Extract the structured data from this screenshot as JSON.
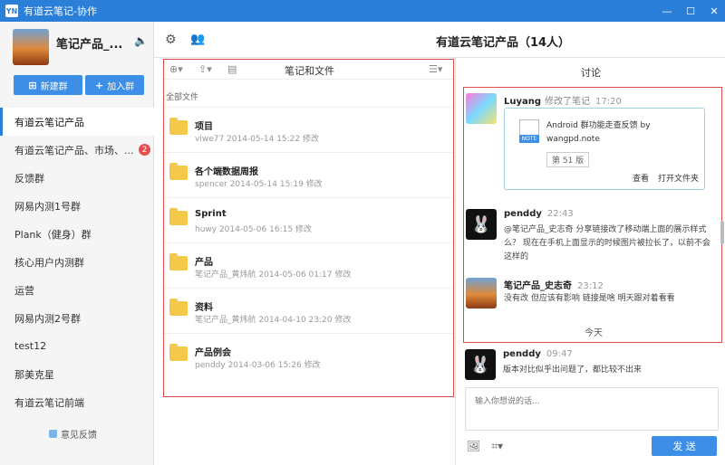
{
  "window": {
    "title": "有道云笔记-协作",
    "app_icon": "YN"
  },
  "group": {
    "name": "笔记产品_...",
    "speaker_icon": "speaker-icon"
  },
  "buttons": {
    "new_group": "新建群",
    "join_group": "加入群"
  },
  "groups": [
    {
      "label": "有道云笔记产品",
      "active": true
    },
    {
      "label": "有道云笔记产品、市场、...",
      "badge": "2"
    },
    {
      "label": "反馈群"
    },
    {
      "label": "网易内测1号群"
    },
    {
      "label": "Plank（健身）群"
    },
    {
      "label": "核心用户内测群"
    },
    {
      "label": "运营"
    },
    {
      "label": "网易内测2号群"
    },
    {
      "label": "test12"
    },
    {
      "label": "那美克星"
    },
    {
      "label": "有道云笔记前端"
    }
  ],
  "feedback": "意见反馈",
  "header": {
    "title": "有道云笔记产品（14人）"
  },
  "files": {
    "title": "笔记和文件",
    "breadcrumb": "全部文件",
    "items": [
      {
        "name": "项目",
        "meta": "viwe77 2014-05-14 15:22 修改"
      },
      {
        "name": "各个端数据周报",
        "meta": "spencer 2014-05-14 15:19 修改"
      },
      {
        "name": "Sprint",
        "meta": "huwy 2014-05-06 16:15 修改"
      },
      {
        "name": "产品",
        "meta": "笔记产品_黄炜航 2014-05-06 01:17 修改"
      },
      {
        "name": "资料",
        "meta": "笔记产品_黄炜航 2014-04-10 23:20 修改"
      },
      {
        "name": "产品例会",
        "meta": "penddy 2014-03-06 15:26 修改"
      }
    ]
  },
  "discussion": {
    "title": "讨论",
    "messages": [
      {
        "name": "Luyang",
        "action": "修改了笔记",
        "time": "17:20",
        "card": {
          "title": "Android 群功能走查反馈 by wangpd.note",
          "version": "第 51 版",
          "view": "查看",
          "open_folder": "打开文件夹"
        }
      },
      {
        "name": "penddy",
        "time": "22:43",
        "text": "@笔记产品_史志奇 分享链接改了移动端上面的展示样式么？ 现在在手机上面显示的时候图片被拉长了，以前不会这样的"
      },
      {
        "name": "笔记产品_史志奇",
        "time": "23:12",
        "text": "没有改 但应该有影响 链接是啥 明天跟对着看看"
      }
    ],
    "divider": "今天",
    "latest": {
      "name": "penddy",
      "time": "09:47",
      "text": "版本对比似乎出问题了，都比较不出来"
    },
    "input_placeholder": "输入你想说的话...",
    "send": "发 送"
  }
}
